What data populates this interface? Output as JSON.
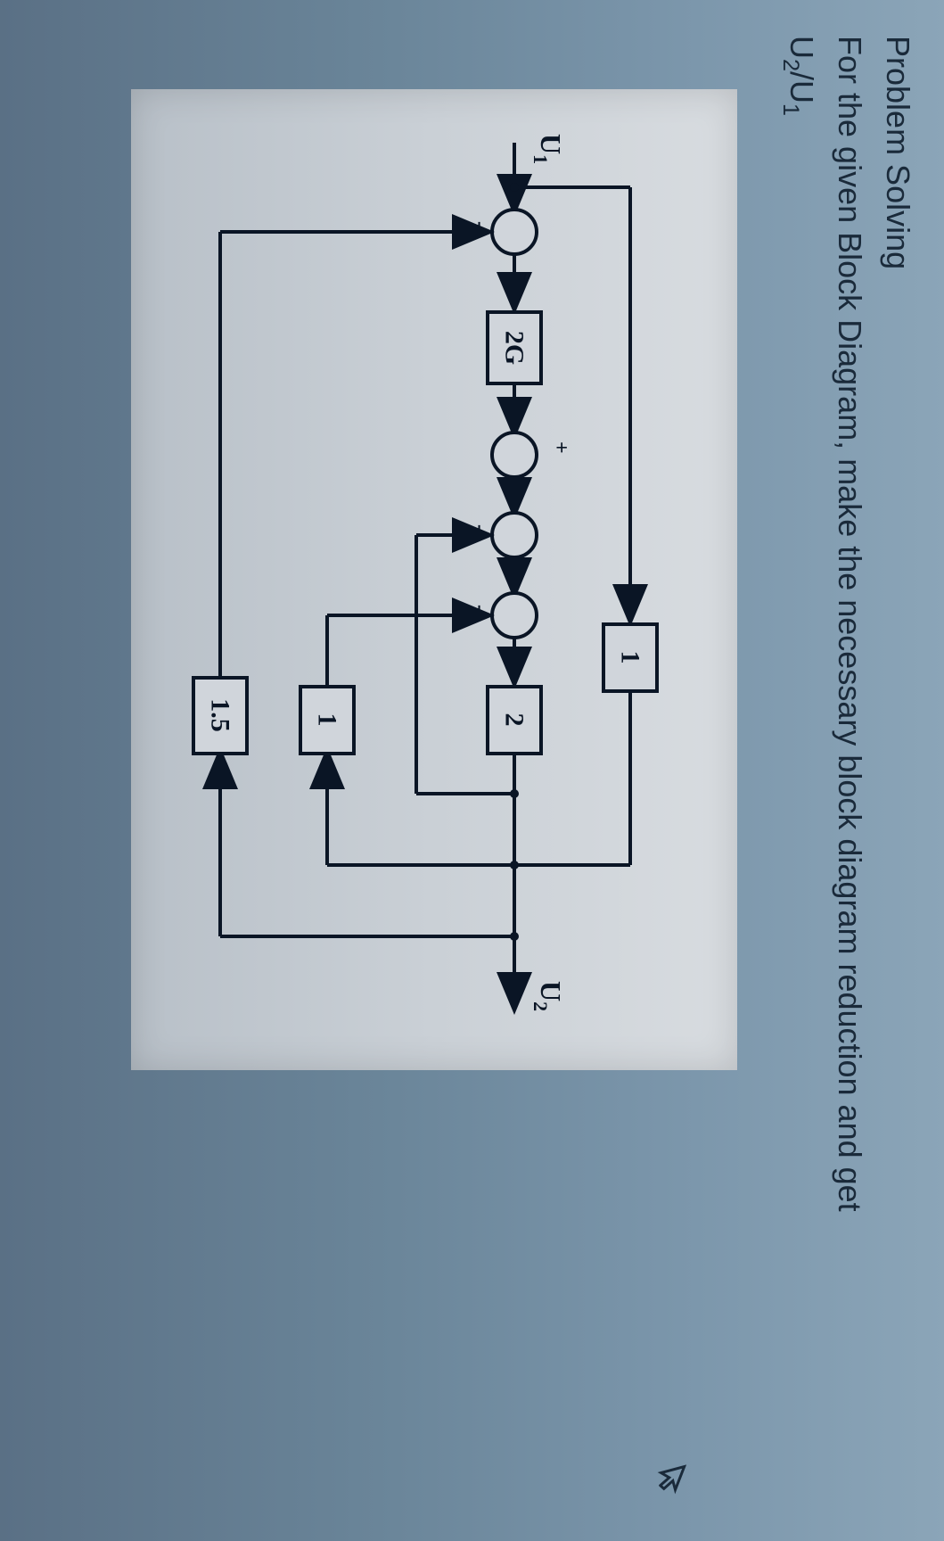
{
  "problem": {
    "title": "Problem Solving",
    "instruction_prefix": "For the given Block Diagram, make the necessary block diagram reduction and get",
    "ratio_numerator": "U",
    "ratio_num_sub": "2",
    "ratio_slash": "/",
    "ratio_denominator": "U",
    "ratio_den_sub": "1"
  },
  "diagram": {
    "input_label": "U",
    "input_sub": "1",
    "output_label": "U",
    "output_sub": "2",
    "block_forward_top": "1",
    "block_forward_main": "2G",
    "block_gain_2": "2",
    "block_feedback_1": "1",
    "block_feedback_15": "1.5",
    "sign_plus": "+",
    "sign_minus": "-"
  }
}
